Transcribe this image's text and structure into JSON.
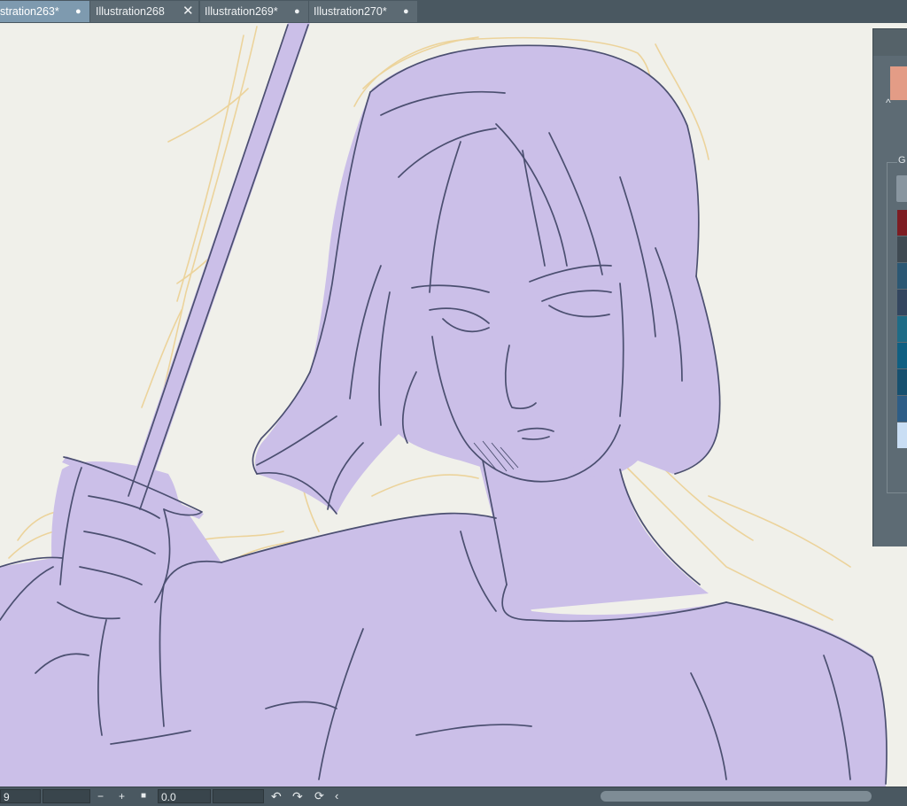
{
  "tabs": [
    {
      "label": "stration263*",
      "mark": "●",
      "active": true
    },
    {
      "label": "Illustration268",
      "mark": "✕",
      "active": false
    },
    {
      "label": "Illustration269*",
      "mark": "●",
      "active": false
    },
    {
      "label": "Illustration270*",
      "mark": "●",
      "active": false
    }
  ],
  "color_panel": {
    "group_label": "G",
    "main_color": "#e39c86",
    "palette": [
      "#7d1c22",
      "#3f4a52",
      "#2b5773",
      "#33465f",
      "#1e6b86",
      "#0f5f82",
      "#16506f",
      "#2d5d86",
      "#c9def4"
    ]
  },
  "statusbar": {
    "zoom_value": "9",
    "rotation_value": "0.0",
    "minus": "−",
    "plus": "+",
    "square": "■",
    "undo": "↶",
    "redo": "↷",
    "reset": "⟳",
    "collapse": "‹"
  },
  "colors": {
    "tab_bar": "#4a5861",
    "active_tab": "#7e9aaf",
    "canvas_paper": "#f0f0ea",
    "sketch_fill": "#cbbfe8",
    "line_art": "#4b4f70",
    "rough_sketch": "#ecd39b"
  }
}
